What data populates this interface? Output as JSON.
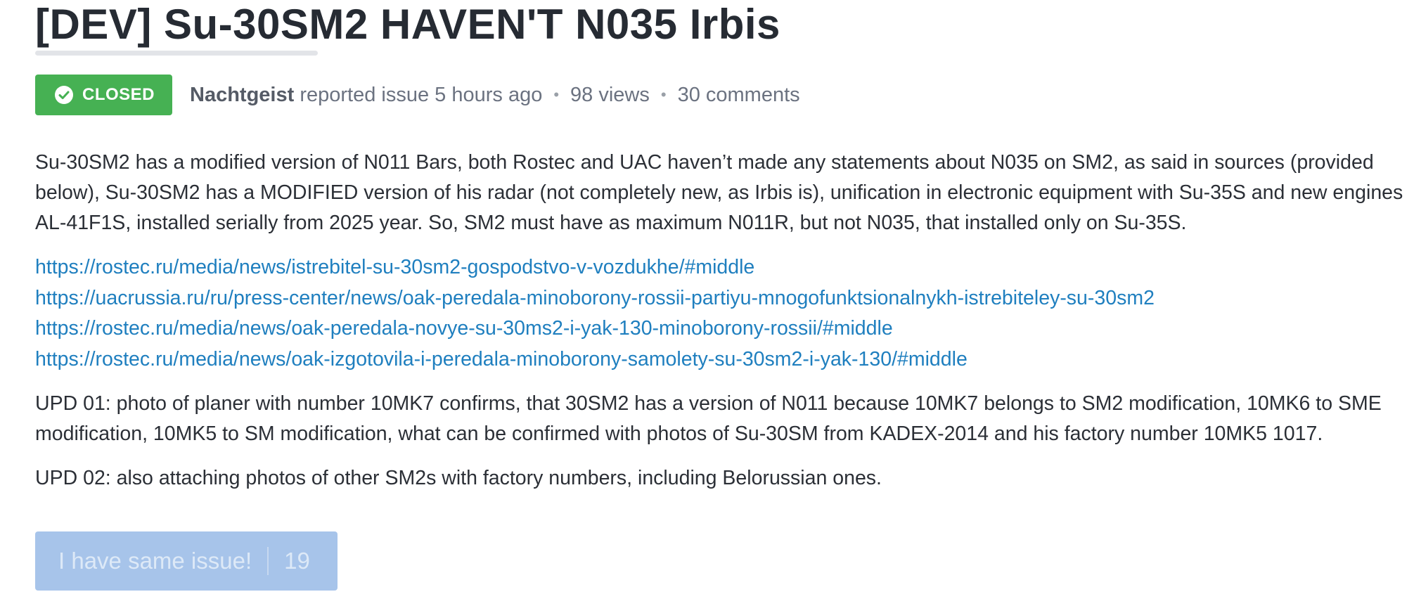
{
  "issue": {
    "title": "[DEV] Su-30SM2 HAVEN'T N035 Irbis",
    "status": "CLOSED",
    "status_color": "#46b153",
    "author": "Nachtgeist",
    "action_text": "reported issue 5 hours ago",
    "separator": "•",
    "views": "98 views",
    "comments": "30 comments"
  },
  "content": {
    "paragraph1": "Su-30SM2 has a modified version of N011 Bars, both Rostec and UAC haven’t made any statements about N035 on SM2, as said in sources (provided below), Su-30SM2 has a MODIFIED version of his radar (not completely new, as Irbis is), unification in electronic equipment with Su-35S and new engines AL-41F1S, installed serially from 2025 year. So, SM2 must have as maximum N011R, but not N035, that installed only on Su-35S.",
    "links": [
      "https://rostec.ru/media/news/istrebitel-su-30sm2-gospodstvo-v-vozdukhe/#middle",
      "https://uacrussia.ru/ru/press-center/news/oak-peredala-minoborony-rossii-partiyu-mnogofunktsionalnykh-istrebiteley-su-30sm2",
      "https://rostec.ru/media/news/oak-peredala-novye-su-30ms2-i-yak-130-minoborony-rossii/#middle",
      "https://rostec.ru/media/news/oak-izgotovila-i-peredala-minoborony-samolety-su-30sm2-i-yak-130/#middle"
    ],
    "upd01": "UPD 01: photo of planer with number 10MK7 confirms, that 30SM2 has a version of N011 because 10MK7 belongs to SM2 modification, 10MK6 to SME modification, 10MK5 to SM modification, what can be confirmed with photos of Su-30SM from KADEX-2014 and his factory number 10MK5 1017.",
    "upd02": "UPD 02: also attaching photos of other SM2s with factory numbers, including Belorussian ones."
  },
  "same_issue_button": {
    "label": "I have same issue!",
    "count": "19",
    "color": "#a7c4ea"
  },
  "link_color": "#1f7fbf"
}
